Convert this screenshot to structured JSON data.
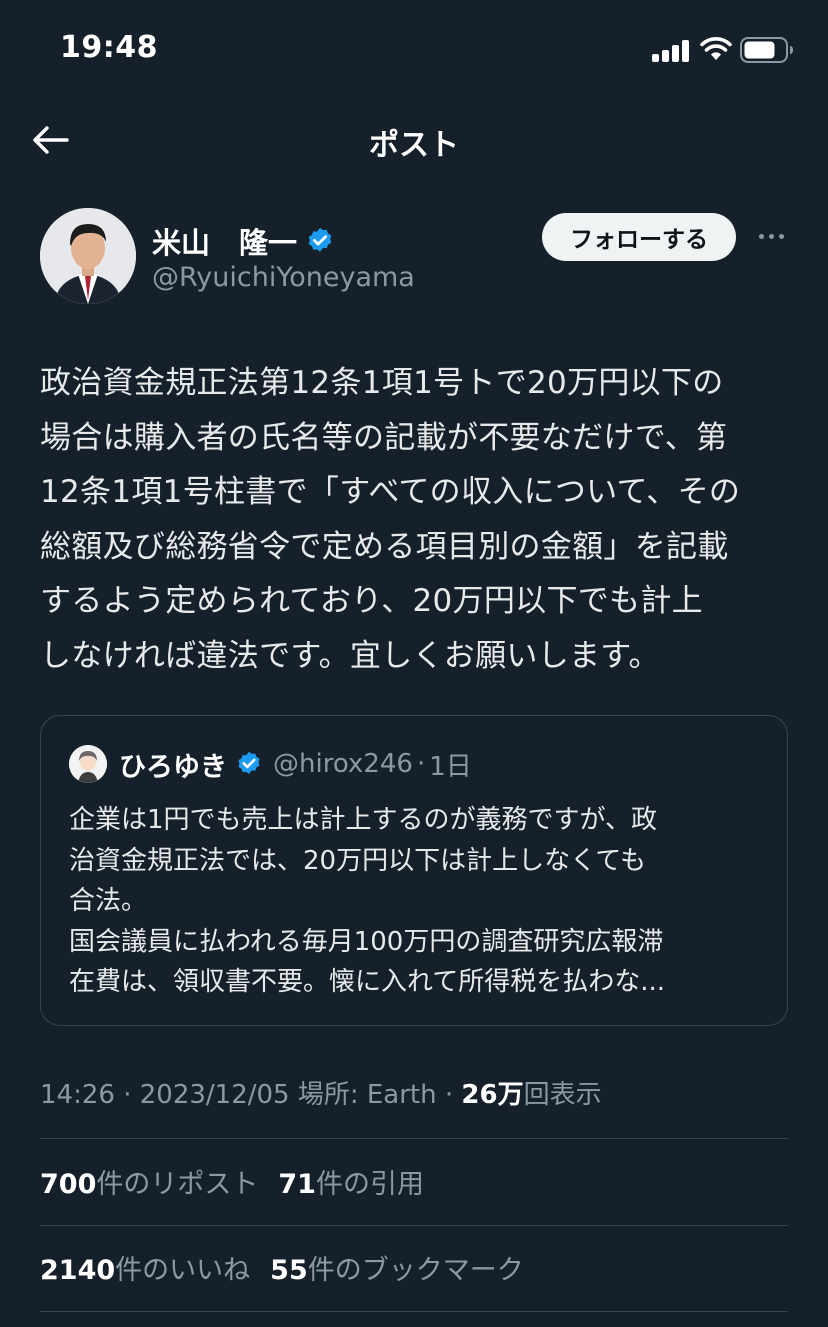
{
  "status_bar": {
    "time": "19:48"
  },
  "header": {
    "title": "ポスト"
  },
  "author": {
    "name": "米山　隆一",
    "handle": "@RyuichiYoneyama",
    "follow_label": "フォローする"
  },
  "tweet": {
    "lines": [
      "政治資金規正法第12条1項1号トで20万円以下の",
      "場合は購入者の氏名等の記載が不要なだけで、第",
      "12条1項1号柱書で「すべての収入について、その",
      "総額及び総務省令で定める項目別の金額」を記載",
      "するよう定められており、20万円以下でも計上",
      "しなければ違法です。宜しくお願いします。"
    ]
  },
  "quote": {
    "name": "ひろゆき",
    "handle": "@hirox246",
    "separator": "·",
    "time": "1日",
    "lines": [
      "企業は1円でも売上は計上するのが義務ですが、政",
      "治資金規正法では、20万円以下は計上しなくても",
      "合法。",
      "国会議員に払われる毎月100万円の調査研究広報滞",
      "在費は、領収書不要。懐に入れて所得税を払わな..."
    ]
  },
  "meta": {
    "time": "14:26",
    "sep1": " · ",
    "date": "2023/12/05",
    "location": " 場所: Earth",
    "sep2": " · ",
    "views_count": "26万",
    "views_label": "回表示"
  },
  "stats": {
    "reposts_count": "700",
    "reposts_label": "件のリポスト",
    "quotes_count": "71",
    "quotes_label": "件の引用",
    "likes_count": "2140",
    "likes_label": "件のいいね",
    "bookmarks_count": "55",
    "bookmarks_label": "件のブックマーク"
  },
  "colors": {
    "background": "#15202b",
    "verified": "#1d9bf0",
    "secondary_text": "#8b98a5",
    "border": "#38444d"
  }
}
